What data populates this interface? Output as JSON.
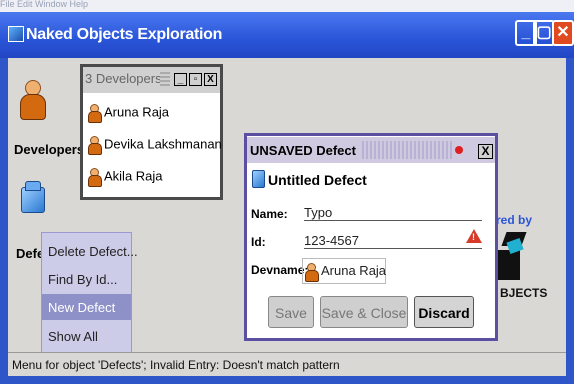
{
  "top_strip": {
    "text": "File    Edit    Window    Help"
  },
  "window": {
    "title": "Naked Objects Exploration"
  },
  "desktop": {
    "developers_label": "Developers",
    "defects_label": "Defe"
  },
  "developers_window": {
    "title": "3 Developers",
    "items": [
      "Aruna Raja",
      "Devika Lakshmanan",
      "Akila Raja"
    ]
  },
  "defect_window": {
    "title": "UNSAVED Defect",
    "heading": "Untitled Defect",
    "fields": {
      "name_label": "Name:",
      "name_value": "Typo",
      "id_label": "Id:",
      "id_value": "123-4567",
      "devname_label": "Devname:",
      "devname_value": "Aruna Raja"
    },
    "buttons": {
      "save": "Save",
      "save_close": "Save & Close",
      "discard": "Discard"
    }
  },
  "background_logo": {
    "line1": "red by",
    "line2": "BJECTS"
  },
  "context_menu": {
    "items": [
      "Delete Defect...",
      "Find By Id...",
      "New Defect",
      "Show All"
    ],
    "highlighted_index": 2
  },
  "status_bar": {
    "text": "Menu for object 'Defects';  Invalid Entry: Doesn't match pattern"
  },
  "colors": {
    "title_blue": "#2a55d8",
    "desk_gray": "#d9d8d4",
    "menu_lavender": "#cccce8",
    "highlight": "#8e90c8"
  }
}
